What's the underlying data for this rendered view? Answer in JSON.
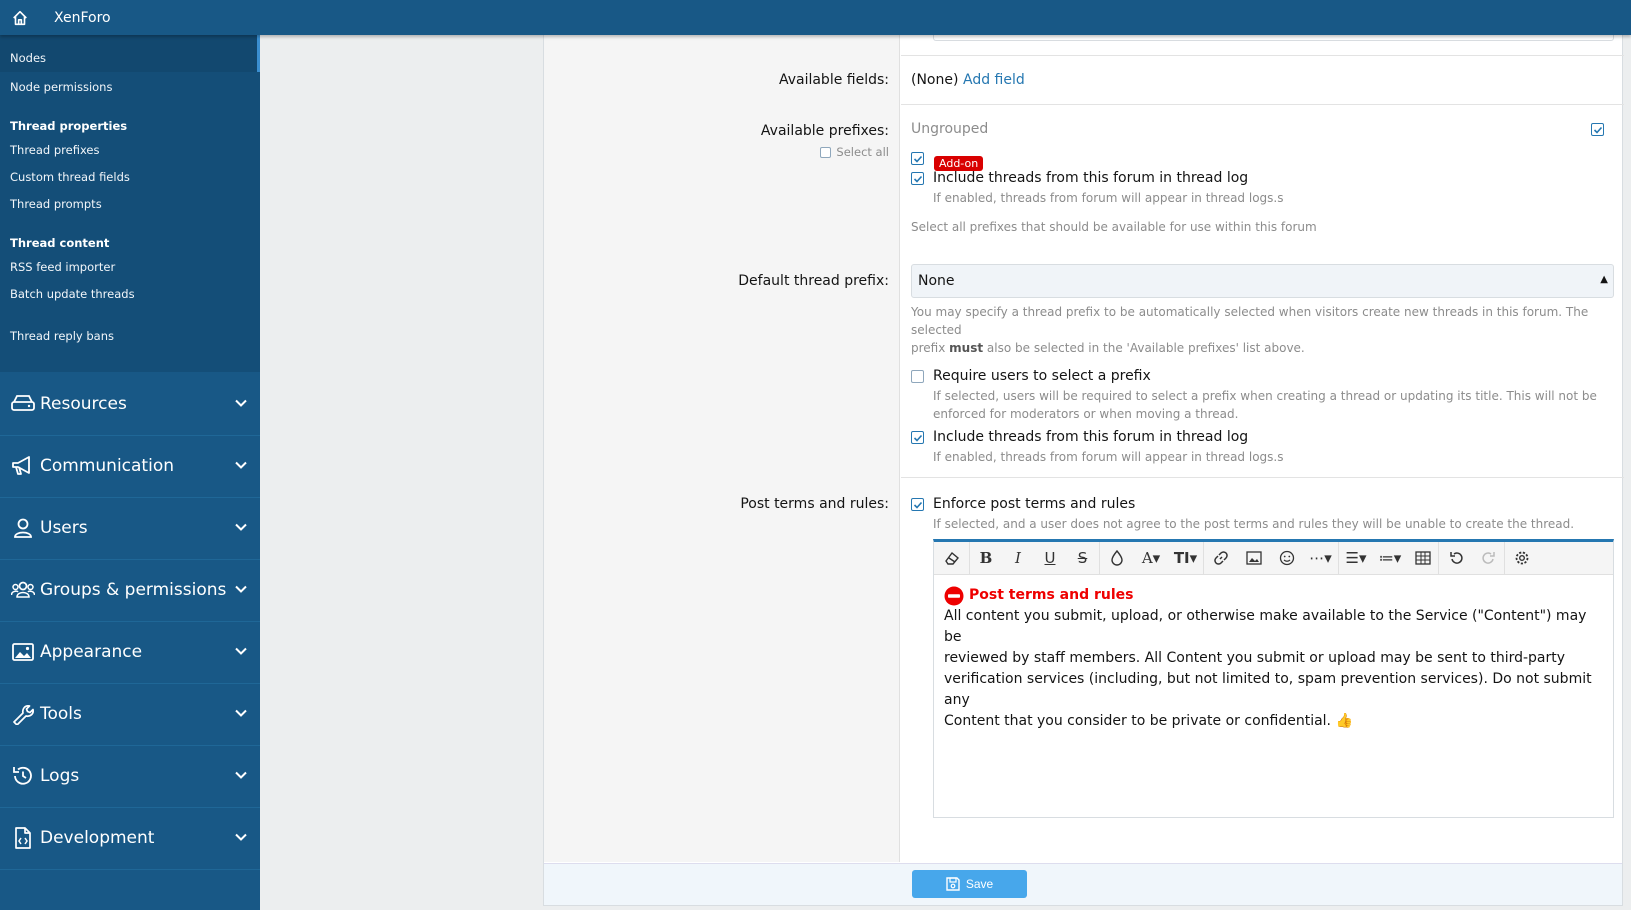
{
  "header": {
    "brand": "XenForo"
  },
  "sidebar": {
    "sub_items": [
      "Nodes",
      "Node permissions"
    ],
    "groups": [
      {
        "heading": "Thread properties",
        "items": [
          "Thread prefixes",
          "Custom thread fields",
          "Thread prompts"
        ]
      },
      {
        "heading": "Thread content",
        "items": [
          "RSS feed importer",
          "Batch update threads"
        ]
      }
    ],
    "last_item": "Thread reply bans",
    "nav": [
      "Resources",
      "Communication",
      "Users",
      "Groups & permissions",
      "Appearance",
      "Tools",
      "Logs",
      "Development"
    ]
  },
  "form": {
    "available_fields": {
      "label": "Available fields:",
      "value": "(None)",
      "link": "Add field"
    },
    "available_prefixes": {
      "label": "Available prefixes:",
      "select_all": "Select all",
      "group": "Ungrouped",
      "badge": "Add-on",
      "option": "Include threads from this forum in thread log",
      "option_hint": "If enabled, threads from forum will appear in thread logs.s",
      "hint": "Select all prefixes that should be available for use within this forum"
    },
    "default_prefix": {
      "label": "Default thread prefix:",
      "value": "None",
      "hint_1": "You may specify a thread prefix to be automatically selected when visitors create new threads in this forum. The selected",
      "hint_2a": "prefix ",
      "hint_2b": "must",
      "hint_2c": " also be selected in the 'Available prefixes' list above."
    },
    "require_prefix": {
      "label": "Require users to select a prefix",
      "hint_1": "If selected, users will be required to select a prefix when creating a thread or updating its title. This will not be",
      "hint_2": "enforced for moderators or when moving a thread."
    },
    "thread_log": {
      "label": "Include threads from this forum in thread log",
      "hint": "If enabled, threads from forum will appear in thread logs.s"
    },
    "post_terms": {
      "label": "Post terms and rules:",
      "option": "Enforce post terms and rules",
      "hint": "If selected, and a user does not agree to the post terms and rules they will be unable to create the thread.",
      "editor_title": "Post terms and rules",
      "editor_lines": [
        "All content you submit, upload, or otherwise make available to the Service (\"Content\") may be",
        "reviewed by staff members. All Content you submit or upload may be sent to third-party",
        "verification services (including, but not limited to, spam prevention services). Do not submit any",
        "Content that you consider to be private or confidential."
      ],
      "emoji": "👍"
    },
    "save": "Save"
  },
  "colors": {
    "primary": "#185886",
    "accent": "#2577b1",
    "save_button": "#47a7eb",
    "badge": "#d90000"
  }
}
